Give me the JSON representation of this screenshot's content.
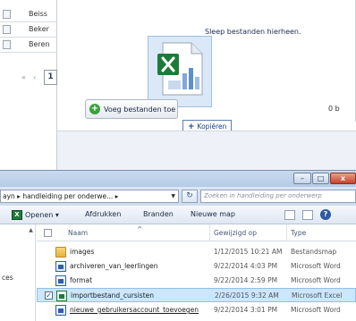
{
  "upload": {
    "left_rows": [
      "Beiss",
      "Beker",
      "Beren"
    ],
    "pager_first": "«",
    "pager_prev": "‹",
    "pager_page": "1",
    "drop_hint": "Sleep bestanden hierheen.",
    "add_button": "Voeg bestanden toe",
    "copy_tooltip": "Kopiëren",
    "total_size": "0 b"
  },
  "explorer": {
    "window_buttons": {
      "minimize": "–",
      "maximize": "□",
      "close": "x"
    },
    "address": "ayn ▸ handleiding per onderwe... ▸",
    "search_placeholder": "Zoeken in handleiding per onderwerp",
    "commands": {
      "open": "Openen ▾",
      "print": "Afdrukken",
      "burn": "Branden",
      "new_folder": "Nieuwe map"
    },
    "nav_labels": [
      "ces"
    ],
    "columns": {
      "name": "Naam",
      "modified": "Gewijzigd op",
      "type": "Type"
    },
    "files": [
      {
        "name": "images",
        "modified": "1/12/2015 10:21 AM",
        "type": "Bestandsmap",
        "icon": "folder-icon",
        "selected": false
      },
      {
        "name": "archiveren_van_leerlingen",
        "modified": "9/22/2014 4:03 PM",
        "type": "Microsoft Word",
        "icon": "word-document-icon",
        "selected": false
      },
      {
        "name": "format",
        "modified": "9/22/2014 2:59 PM",
        "type": "Microsoft Word",
        "icon": "word-document-icon",
        "selected": false
      },
      {
        "name": "importbestand_cursisten",
        "modified": "2/26/2015 9:32 AM",
        "type": "Microsoft Excel",
        "icon": "excel-document-icon",
        "selected": true
      },
      {
        "name": "nieuwe_gebruikersaccount_toevoegen",
        "modified": "9/22/2014 3:01 PM",
        "type": "Microsoft Word",
        "icon": "word-document-icon",
        "selected": false
      }
    ]
  }
}
